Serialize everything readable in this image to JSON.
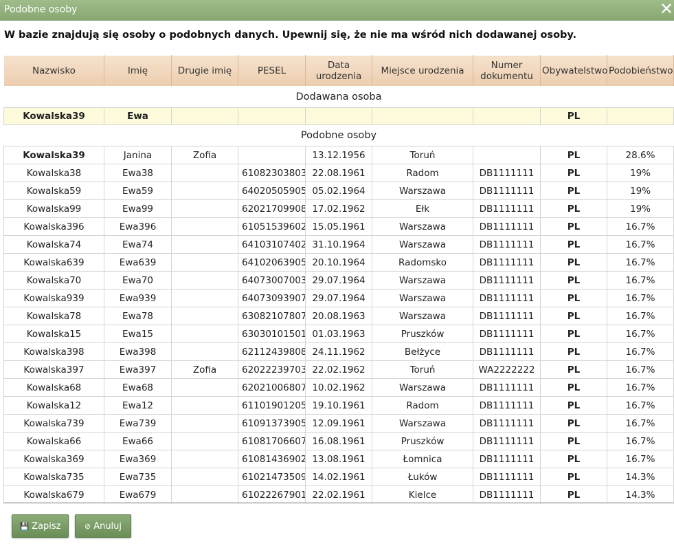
{
  "dialog": {
    "title": "Podobne osoby",
    "close_icon": "close-icon",
    "intro": "W bazie znajdują się osoby o podobnych danych. Upewnij się, że nie ma wśród nich dodawanej osoby."
  },
  "columns": [
    "Nazwisko",
    "Imię",
    "Drugie imię",
    "PESEL",
    "Data urodzenia",
    "Miejsce urodzenia",
    "Numer dokumentu",
    "Obywatelstwo",
    "Podobieństwo"
  ],
  "sections": {
    "added": "Dodawana osoba",
    "similar": "Podobne osoby"
  },
  "added_person": [
    "Kowalska39",
    "Ewa",
    "",
    "",
    "",
    "",
    "",
    "PL",
    ""
  ],
  "similar_people": [
    [
      "Kowalska39",
      "Janina",
      "Zofia",
      "",
      "13.12.1956",
      "Toruń",
      "",
      "PL",
      "28.6%"
    ],
    [
      "Kowalska38",
      "Ewa38",
      "",
      "61082303803",
      "22.08.1961",
      "Radom",
      "DB1111111",
      "PL",
      "19%"
    ],
    [
      "Kowalska59",
      "Ewa59",
      "",
      "64020505905",
      "05.02.1964",
      "Warszawa",
      "DB1111111",
      "PL",
      "19%"
    ],
    [
      "Kowalska99",
      "Ewa99",
      "",
      "62021709908",
      "17.02.1962",
      "Ełk",
      "DB1111111",
      "PL",
      "19%"
    ],
    [
      "Kowalska396",
      "Ewa396",
      "",
      "61051539602",
      "15.05.1961",
      "Warszawa",
      "DB1111111",
      "PL",
      "16.7%"
    ],
    [
      "Kowalska74",
      "Ewa74",
      "",
      "64103107402",
      "31.10.1964",
      "Warszawa",
      "DB1111111",
      "PL",
      "16.7%"
    ],
    [
      "Kowalska639",
      "Ewa639",
      "",
      "64102063905",
      "20.10.1964",
      "Radomsko",
      "DB1111111",
      "PL",
      "16.7%"
    ],
    [
      "Kowalska70",
      "Ewa70",
      "",
      "64073007003",
      "29.07.1964",
      "Warszawa",
      "DB1111111",
      "PL",
      "16.7%"
    ],
    [
      "Kowalska939",
      "Ewa939",
      "",
      "64073093907",
      "29.07.1964",
      "Warszawa",
      "DB1111111",
      "PL",
      "16.7%"
    ],
    [
      "Kowalska78",
      "Ewa78",
      "",
      "63082107807",
      "20.08.1963",
      "Warszawa",
      "DB1111111",
      "PL",
      "16.7%"
    ],
    [
      "Kowalska15",
      "Ewa15",
      "",
      "63030101501",
      "01.03.1963",
      "Pruszków",
      "DB1111111",
      "PL",
      "16.7%"
    ],
    [
      "Kowalska398",
      "Ewa398",
      "",
      "62112439808",
      "24.11.1962",
      "Bełżyce",
      "DB1111111",
      "PL",
      "16.7%"
    ],
    [
      "Kowalska397",
      "Ewa397",
      "Zofia",
      "62022239703",
      "22.02.1962",
      "Toruń",
      "WA2222222",
      "PL",
      "16.7%"
    ],
    [
      "Kowalska68",
      "Ewa68",
      "",
      "62021006807",
      "10.02.1962",
      "Warszawa",
      "DB1111111",
      "PL",
      "16.7%"
    ],
    [
      "Kowalska12",
      "Ewa12",
      "",
      "61101901205",
      "19.10.1961",
      "Radom",
      "DB1111111",
      "PL",
      "16.7%"
    ],
    [
      "Kowalska739",
      "Ewa739",
      "",
      "61091373905",
      "12.09.1961",
      "Warszawa",
      "DB1111111",
      "PL",
      "16.7%"
    ],
    [
      "Kowalska66",
      "Ewa66",
      "",
      "61081706607",
      "16.08.1961",
      "Pruszków",
      "DB1111111",
      "PL",
      "16.7%"
    ],
    [
      "Kowalska369",
      "Ewa369",
      "",
      "61081436902",
      "13.08.1961",
      "Łomnica",
      "DB1111111",
      "PL",
      "16.7%"
    ],
    [
      "Kowalska735",
      "Ewa735",
      "",
      "61021473509",
      "14.02.1961",
      "Łuków",
      "DB1111111",
      "PL",
      "14.3%"
    ],
    [
      "Kowalska679",
      "Ewa679",
      "",
      "61022267901",
      "22.02.1961",
      "Kielce",
      "DB1111111",
      "PL",
      "14.3%"
    ]
  ],
  "buttons": {
    "save": {
      "icon": "floppy-disk-icon",
      "label": "Zapisz"
    },
    "cancel": {
      "icon": "ban-icon",
      "label": "Anuluj"
    }
  },
  "colors": {
    "titlebar": "#94b27e",
    "header_bg": "#f1d6bb",
    "added_row_bg": "#fdfbdc",
    "button_bg": "#7a9c66"
  }
}
